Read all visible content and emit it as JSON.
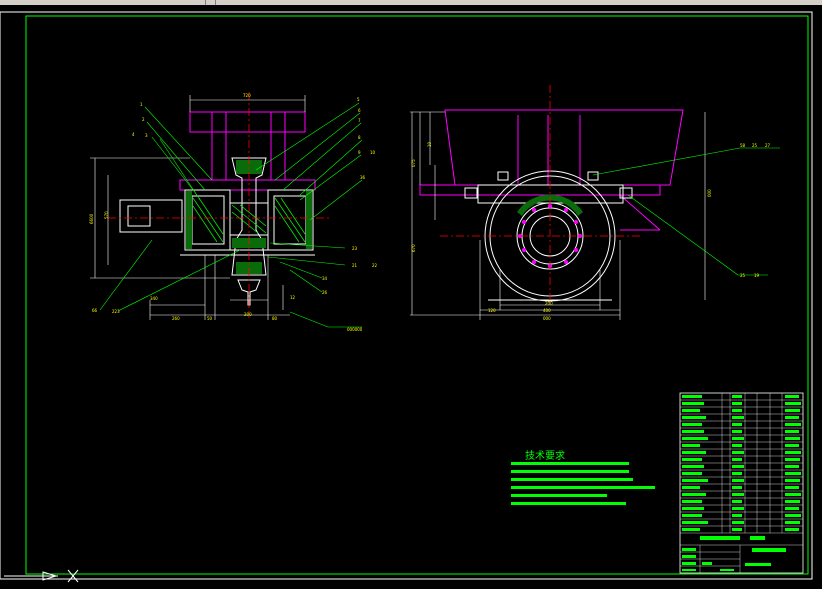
{
  "colors": {
    "background": "#000000",
    "border": "#00ff00",
    "outline": "#ffffff",
    "frame": "#ff00ff",
    "center_line": "#ff0000",
    "label": "#ffff00",
    "leader": "#00ff00"
  },
  "drawing": {
    "tech_title": "技术要求",
    "left_view_labels": [
      "1",
      "2",
      "3",
      "4",
      "5",
      "6",
      "7",
      "8",
      "9",
      "10",
      "11",
      "12",
      "13",
      "14",
      "15",
      "16",
      "17",
      "18",
      "19",
      "20",
      "21"
    ],
    "right_view_labels": [
      "22",
      "23",
      "24",
      "25",
      "26",
      "27"
    ],
    "icons": [
      "ucs-x-axis-icon",
      "ucs-arrow-icon"
    ]
  }
}
